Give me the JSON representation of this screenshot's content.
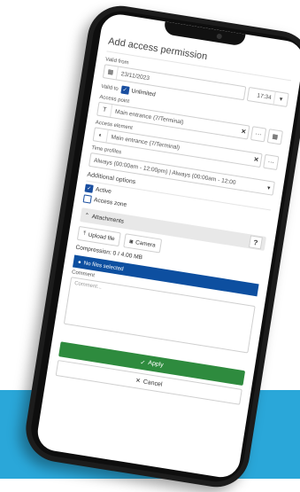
{
  "title": "Add access permission",
  "valid_from": {
    "label": "Valid from",
    "date": "23/11/2023",
    "time": "17:34"
  },
  "valid_to": {
    "label": "Valid to",
    "unlimited_label": "Unlimited",
    "unlimited_checked": true
  },
  "access_point": {
    "label": "Access point",
    "value": "Main entrance (7/Terminal)"
  },
  "access_element": {
    "label": "Access element",
    "value": "Main entrance (7/Terminal)"
  },
  "time_profiles": {
    "label": "Time profiles",
    "value": "Always (00:00am - 12:00pm) | Always (00:00am - 12:00"
  },
  "additional_options": {
    "label": "Additional options",
    "active_label": "Active",
    "active_checked": true,
    "access_zone_label": "Access zone",
    "access_zone_checked": false
  },
  "attachments": {
    "label": "Attachments",
    "help": "?",
    "upload_label": "Upload file",
    "camera_label": "Camera",
    "compression": "Compression: 0 / 4.00 MB",
    "no_files": "No files selected"
  },
  "comment": {
    "label": "Comment",
    "placeholder": "Comment..."
  },
  "actions": {
    "apply": "Apply",
    "cancel": "Cancel"
  },
  "colors": {
    "accent_blue": "#0d4fa0",
    "apply_green": "#2e8b3e",
    "band": "#2aa7d9"
  }
}
